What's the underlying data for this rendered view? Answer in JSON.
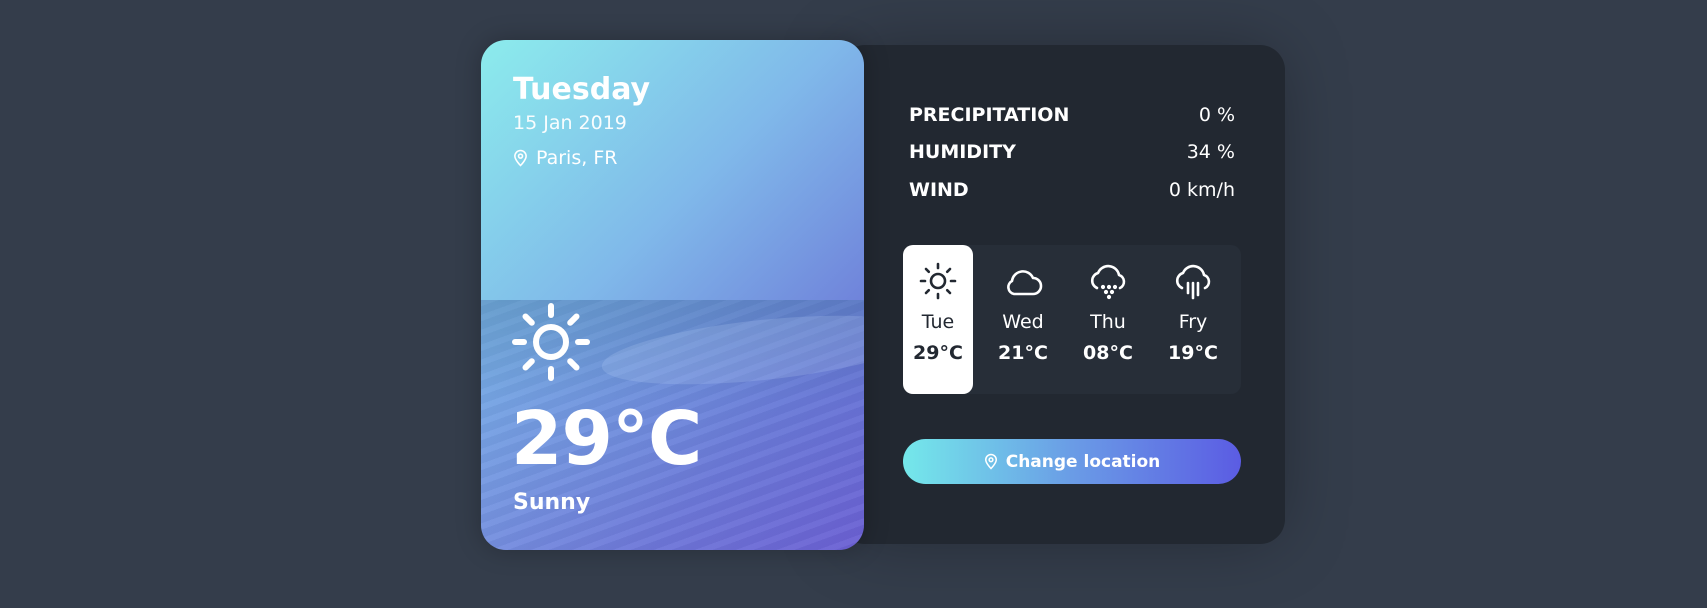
{
  "today": {
    "day": "Tuesday",
    "date": "15 Jan 2019",
    "location": "Paris, FR",
    "temperature": "29°C",
    "description": "Sunny",
    "icon": "sun-icon"
  },
  "stats": [
    {
      "label": "PRECIPITATION",
      "value": "0 %"
    },
    {
      "label": "HUMIDITY",
      "value": "34 %"
    },
    {
      "label": "WIND",
      "value": "0 km/h"
    }
  ],
  "week": [
    {
      "day": "Tue",
      "temp": "29°C",
      "icon": "sun-icon",
      "active": true
    },
    {
      "day": "Wed",
      "temp": "21°C",
      "icon": "cloud-icon",
      "active": false
    },
    {
      "day": "Thu",
      "temp": "08°C",
      "icon": "cloud-snow-icon",
      "active": false
    },
    {
      "day": "Fry",
      "temp": "19°C",
      "icon": "cloud-rain-icon",
      "active": false
    }
  ],
  "button": {
    "label": "Change location",
    "icon": "map-pin-icon"
  },
  "colors": {
    "background": "#343d4b",
    "panel": "#222831",
    "gradient_start": "#74e8ea",
    "gradient_end": "#5b5ce3"
  }
}
